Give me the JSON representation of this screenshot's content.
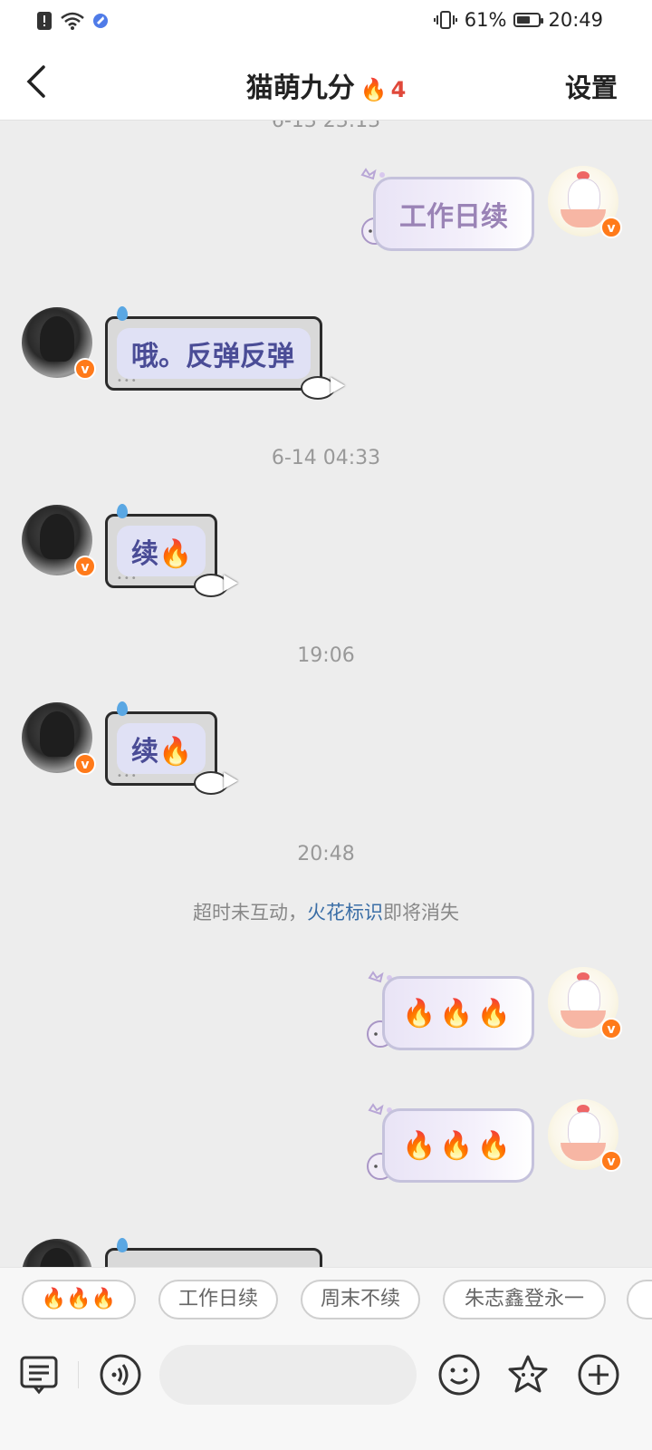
{
  "status_bar": {
    "battery_percent": "61%",
    "battery_level": 0.61,
    "time": "20:49"
  },
  "header": {
    "title": "猫萌九分",
    "streak_icon": "🔥",
    "streak_count": "4",
    "settings_label": "设置"
  },
  "chat": {
    "top_timestamp_partial": "6-13 23:13",
    "messages": [
      {
        "side": "me",
        "text": "工作日续"
      },
      {
        "side": "friend",
        "text": "哦。反弹反弹"
      },
      {
        "timestamp": "6-14 04:33"
      },
      {
        "side": "friend",
        "text": "续🔥"
      },
      {
        "timestamp": "19:06"
      },
      {
        "side": "friend",
        "text": "续🔥"
      },
      {
        "timestamp": "20:48"
      }
    ],
    "notice_prefix": "超时未互动，",
    "notice_highlight": "火花标识",
    "notice_suffix": "即将消失",
    "me_flames_1": "🔥🔥🔥",
    "me_flames_2": "🔥🔥🔥",
    "badge_letter": "v"
  },
  "quick_replies": [
    "🔥🔥🔥",
    "工作日续",
    "周末不续",
    "朱志鑫登永一"
  ],
  "toolbar": {
    "input_placeholder": "",
    "icons": [
      "notes-icon",
      "voice-icon",
      "emoji-icon",
      "sticker-icon",
      "add-icon"
    ]
  },
  "colors": {
    "accent_flame": "#e0483a",
    "notice_link": "#3b6ea6",
    "pixel_text": "#4a4c96",
    "lilac_text": "#9a83b6",
    "badge": "#ff7a1a"
  }
}
